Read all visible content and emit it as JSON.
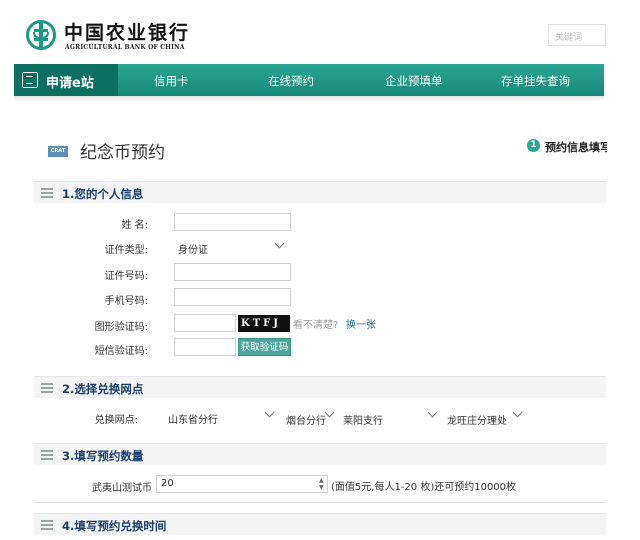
{
  "header": {
    "bank_name_cn": "中国农业银行",
    "bank_name_en": "AGRICULTURAL BANK OF CHINA",
    "search_placeholder": "关键词"
  },
  "nav": {
    "apply_label": "申请e站",
    "items": [
      "信用卡",
      "在线预约",
      "企业预填单",
      "存单挂失查询"
    ]
  },
  "page": {
    "title_icon_text": "CRAT",
    "title": "纪念币预约",
    "info_step_number": "1",
    "info_step_label": "预约信息填写"
  },
  "section1": {
    "title": "1.您的个人信息",
    "name_label": "姓 名:",
    "id_type_label": "证件类型:",
    "id_type_value": "身份证",
    "id_number_label": "证件号码:",
    "phone_label": "手机号码:",
    "captcha_label": "图形验证码:",
    "captcha_text": "KTFJ",
    "captcha_unclear": "看不清楚?",
    "captcha_change": "换一张",
    "sms_label": "短信验证码:",
    "sms_button": "获取验证码"
  },
  "section2": {
    "title": "2.选择兑换网点",
    "outlet_label": "兑换网点:",
    "selects": [
      "山东省分行",
      "烟台分行",
      "莱阳支行",
      "龙旺庄分理处"
    ]
  },
  "section3": {
    "title": "3.填写预约数量",
    "coin_label": "武夷山测试币",
    "quantity_value": "20",
    "quantity_note": "(面值5元,每人1-20 枚)还可预约10000枚"
  },
  "section4": {
    "title": "4.填写预约兑换时间"
  },
  "colors": {
    "nav_green": "#1f9a8a",
    "nav_apply_dark": "#0d6e63",
    "section_title_blue": "#1a3e6e",
    "link_blue": "#1f6fa8"
  }
}
